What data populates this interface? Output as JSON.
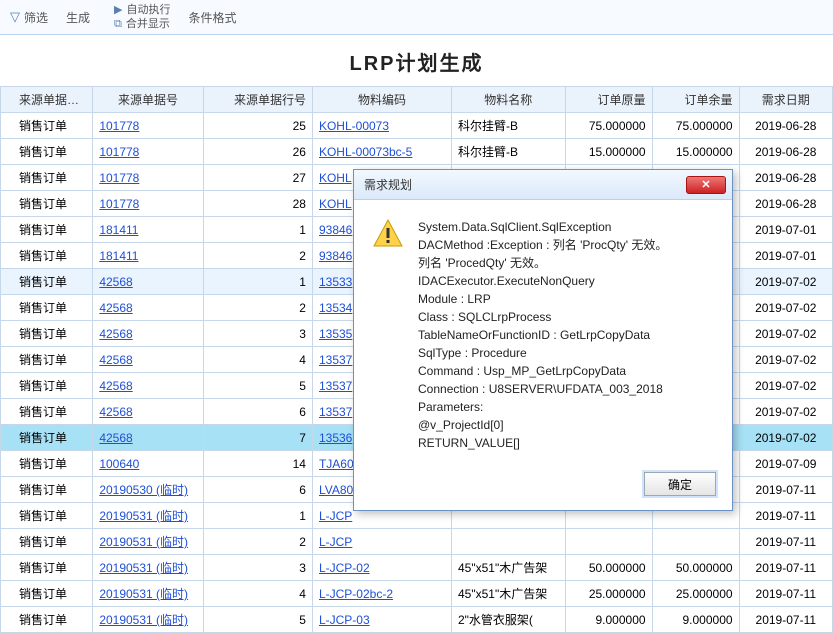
{
  "toolbar": {
    "filter": "筛选",
    "generate": "生成",
    "auto_run": "自动执行",
    "merge_show": "合并显示",
    "cond_fmt": "条件格式"
  },
  "title": "LRP计划生成",
  "columns": [
    "来源单据类别",
    "来源单据号",
    "来源单据行号",
    "物料编码",
    "物料名称",
    "订单原量",
    "订单余量",
    "需求日期"
  ],
  "rows": [
    {
      "c0": "销售订单",
      "c1": "101778",
      "c2": "25",
      "c3": "KOHL-00073",
      "c4": "科尔挂臂-B",
      "c5": "75.000000",
      "c6": "75.000000",
      "c7": "2019-06-28"
    },
    {
      "c0": "销售订单",
      "c1": "101778",
      "c2": "26",
      "c3": "KOHL-00073bc-5",
      "c4": "科尔挂臂-B",
      "c5": "15.000000",
      "c6": "15.000000",
      "c7": "2019-06-28"
    },
    {
      "c0": "销售订单",
      "c1": "101778",
      "c2": "27",
      "c3": "KOHL",
      "c4": "",
      "c5": "",
      "c6": "",
      "c7": "2019-06-28"
    },
    {
      "c0": "销售订单",
      "c1": "101778",
      "c2": "28",
      "c3": "KOHL",
      "c4": "",
      "c5": "",
      "c6": "",
      "c7": "2019-06-28"
    },
    {
      "c0": "销售订单",
      "c1": "181411",
      "c2": "1",
      "c3": "93846",
      "c4": "",
      "c5": "",
      "c6": "",
      "c7": "2019-07-01"
    },
    {
      "c0": "销售订单",
      "c1": "181411",
      "c2": "2",
      "c3": "93846",
      "c4": "",
      "c5": "",
      "c6": "",
      "c7": "2019-07-01"
    },
    {
      "c0": "销售订单",
      "c1": "42568",
      "c2": "1",
      "c3": "13533",
      "c4": "",
      "c5": "",
      "c6": "",
      "c7": "2019-07-02",
      "alt": true
    },
    {
      "c0": "销售订单",
      "c1": "42568",
      "c2": "2",
      "c3": "13534",
      "c4": "",
      "c5": "",
      "c6": "",
      "c7": "2019-07-02"
    },
    {
      "c0": "销售订单",
      "c1": "42568",
      "c2": "3",
      "c3": "13535",
      "c4": "",
      "c5": "",
      "c6": "",
      "c7": "2019-07-02"
    },
    {
      "c0": "销售订单",
      "c1": "42568",
      "c2": "4",
      "c3": "13537",
      "c4": "",
      "c5": "",
      "c6": "",
      "c7": "2019-07-02"
    },
    {
      "c0": "销售订单",
      "c1": "42568",
      "c2": "5",
      "c3": "13537",
      "c4": "",
      "c5": "",
      "c6": "",
      "c7": "2019-07-02"
    },
    {
      "c0": "销售订单",
      "c1": "42568",
      "c2": "6",
      "c3": "13537",
      "c4": "",
      "c5": "",
      "c6": "",
      "c7": "2019-07-02"
    },
    {
      "c0": "销售订单",
      "c1": "42568",
      "c2": "7",
      "c3": "13536",
      "c4": "",
      "c5": "",
      "c6": "",
      "c7": "2019-07-02",
      "sel": true
    },
    {
      "c0": "销售订单",
      "c1": "100640",
      "c2": "14",
      "c3": "TJA60",
      "c4": "",
      "c5": "",
      "c6": "",
      "c7": "2019-07-09"
    },
    {
      "c0": "销售订单",
      "c1": "20190530 (临时)",
      "c2": "6",
      "c3": "LVA80",
      "c4": "",
      "c5": "",
      "c6": "",
      "c7": "2019-07-11"
    },
    {
      "c0": "销售订单",
      "c1": "20190531 (临时)",
      "c2": "1",
      "c3": "L-JCP",
      "c4": "",
      "c5": "",
      "c6": "",
      "c7": "2019-07-11"
    },
    {
      "c0": "销售订单",
      "c1": "20190531 (临时)",
      "c2": "2",
      "c3": "L-JCP",
      "c4": "",
      "c5": "",
      "c6": "",
      "c7": "2019-07-11"
    },
    {
      "c0": "销售订单",
      "c1": "20190531 (临时)",
      "c2": "3",
      "c3": "L-JCP-02",
      "c4": "45\"x51\"木广告架",
      "c5": "50.000000",
      "c6": "50.000000",
      "c7": "2019-07-11"
    },
    {
      "c0": "销售订单",
      "c1": "20190531 (临时)",
      "c2": "4",
      "c3": "L-JCP-02bc-2",
      "c4": "45\"x51\"木广告架",
      "c5": "25.000000",
      "c6": "25.000000",
      "c7": "2019-07-11"
    },
    {
      "c0": "销售订单",
      "c1": "20190531 (临时)",
      "c2": "5",
      "c3": "L-JCP-03",
      "c4": "2\"水管衣服架(",
      "c5": "9.000000",
      "c6": "9.000000",
      "c7": "2019-07-11"
    }
  ],
  "dialog": {
    "title": "需求规划",
    "lines": [
      "System.Data.SqlClient.SqlException",
      "DACMethod :Exception : 列名 'ProcQty' 无效。",
      "列名 'ProcedQty' 无效。",
      " IDACExecutor.ExecuteNonQuery",
      "Module : LRP",
      "Class : SQLCLrpProcess",
      "TableNameOrFunctionID : GetLrpCopyData",
      "SqlType : Procedure",
      "Command : Usp_MP_GetLrpCopyData",
      "Connection : U8SERVER\\UFDATA_003_2018",
      "Parameters:",
      "@v_ProjectId[0]",
      "RETURN_VALUE[]"
    ],
    "ok": "确定"
  }
}
